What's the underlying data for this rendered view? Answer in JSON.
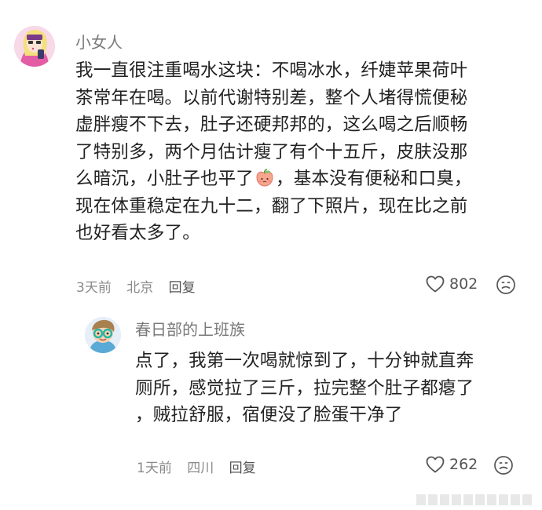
{
  "comments": [
    {
      "username": "小女人",
      "avatar_icon": "girl-avatar-icon",
      "lines": [
        "我一直很注重喝水这块：不喝冰水，纤婕苹果荷叶",
        "茶常年在喝。以前代谢特别差，整个人堵得慌便秘",
        "虚胖瘦不下去，肚子还硬邦邦的，这么喝之后顺畅",
        "了特别多，两个月估计瘦了有个十五斤，皮肤没那",
        "么暗沉，小肚子也平了",
        "，基本没有便秘和口臭，",
        "现在体重稳定在九十二，翻了下照片，现在比之前",
        "也好看太多了。"
      ],
      "time": "3天前",
      "location": "北京",
      "reply_label": "回复",
      "likes": "802"
    }
  ],
  "replies": [
    {
      "username": "春日部的上班族",
      "avatar_icon": "cartoon-avatar-icon",
      "lines": [
        "点了，我第一次喝就惊到了，十分钟就直奔",
        "厕所，感觉拉了三斤，拉完整个肚子都瘪了",
        "，贼拉舒服，宿便没了脸蛋干净了"
      ],
      "time": "1天前",
      "location": "四川",
      "reply_label": "回复",
      "likes": "262"
    }
  ],
  "icons": {
    "like": "heart-outline-icon",
    "dislike": "frown-face-icon",
    "emoji": "peach-emoji-icon"
  }
}
